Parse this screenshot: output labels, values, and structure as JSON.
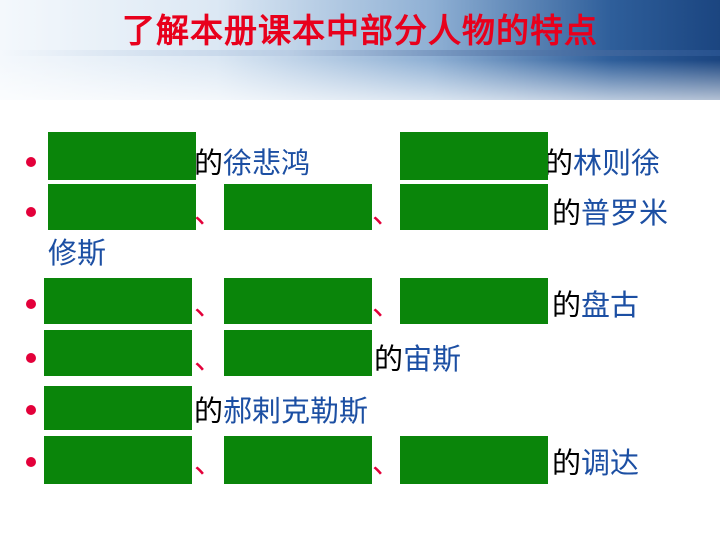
{
  "slide": {
    "title": "了解本册课本中部分人物的特点",
    "colors": {
      "title": "#e8001c",
      "bullet": "#e3003a",
      "name_text": "#1c4fa3",
      "mask": "#0a850a"
    },
    "items": [
      {
        "name1": "徐悲鸿",
        "name2": "林则徐",
        "de": "的"
      },
      {
        "name": "普罗米",
        "wrap": "修斯",
        "sep": "、",
        "de": "的"
      },
      {
        "name": "盘古",
        "sep": "、",
        "de": "的"
      },
      {
        "name": "宙斯",
        "sep": "、",
        "de": "的"
      },
      {
        "name": "郝剌克勒斯",
        "de": "的"
      },
      {
        "name": "调达",
        "sep": "、",
        "de": "的"
      }
    ]
  }
}
